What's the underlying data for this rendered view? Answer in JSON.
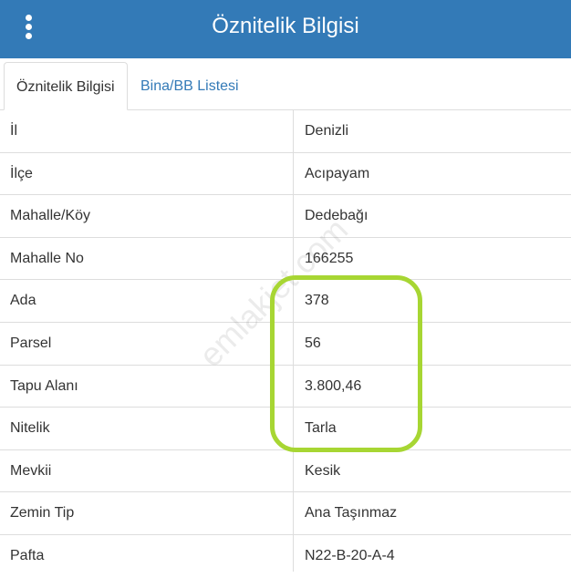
{
  "header": {
    "title": "Öznitelik Bilgisi",
    "menu_icon": "vertical-ellipsis"
  },
  "tabs": [
    {
      "label": "Öznitelik Bilgisi",
      "active": true
    },
    {
      "label": "Bina/BB Listesi",
      "active": false
    }
  ],
  "attributes": [
    {
      "label": "İl",
      "value": "Denizli"
    },
    {
      "label": "İlçe",
      "value": "Acıpayam"
    },
    {
      "label": "Mahalle/Köy",
      "value": "Dedebağı"
    },
    {
      "label": "Mahalle No",
      "value": "166255"
    },
    {
      "label": "Ada",
      "value": "378"
    },
    {
      "label": "Parsel",
      "value": "56"
    },
    {
      "label": "Tapu Alanı",
      "value": "3.800,46"
    },
    {
      "label": "Nitelik",
      "value": "Tarla"
    },
    {
      "label": "Mevkii",
      "value": "Kesik"
    },
    {
      "label": "Zemin Tip",
      "value": "Ana Taşınmaz"
    },
    {
      "label": "Pafta",
      "value": "N22-B-20-A-4"
    }
  ],
  "watermark": "emlakjet.com",
  "colors": {
    "header_bg": "#337ab7",
    "link": "#337ab7",
    "highlight": "#a7d633"
  }
}
